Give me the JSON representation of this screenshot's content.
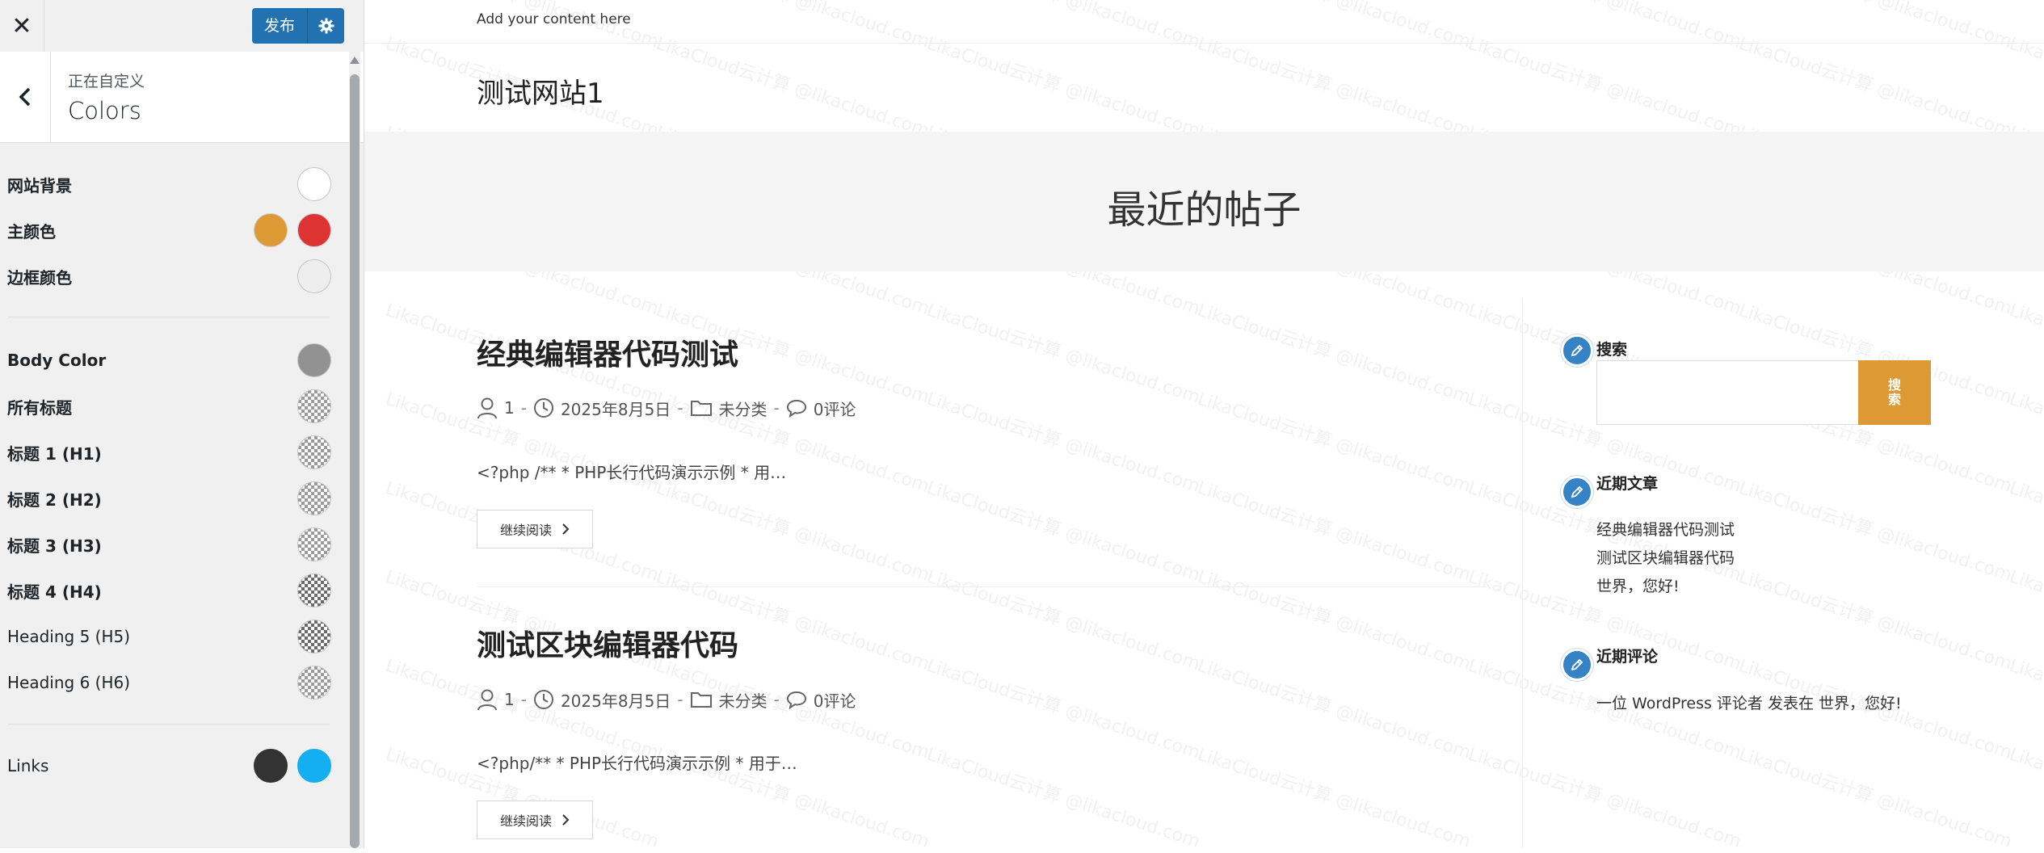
{
  "customizer": {
    "close_icon": "close-icon",
    "publish_label": "发布",
    "publish_settings_icon": "gear-icon",
    "back_icon": "chevron-left-icon",
    "customizing_label": "正在自定义",
    "section_title": "Colors",
    "controls": [
      {
        "label": "网站背景",
        "colors": [
          "#ffffff"
        ]
      },
      {
        "label": "主颜色",
        "colors": [
          "#dd9933",
          "#dd3333"
        ]
      },
      {
        "label": "边框颜色",
        "colors": [
          "#eeeeee"
        ]
      },
      {
        "label": "Body Color",
        "colors": [
          "#929292"
        ]
      },
      {
        "label": "所有标题",
        "colors": [
          "transparent"
        ]
      },
      {
        "label": "标题 1 (H1)",
        "colors": [
          "transparent"
        ]
      },
      {
        "label": "标题 2 (H2)",
        "colors": [
          "transparent"
        ]
      },
      {
        "label": "标题 3 (H3)",
        "colors": [
          "transparent"
        ]
      },
      {
        "label": "标题 4 (H4)",
        "colors": [
          "transparent"
        ]
      },
      {
        "label": "Heading 5 (H5)",
        "colors": [
          "transparent"
        ]
      },
      {
        "label": "Heading 6 (H6)",
        "colors": [
          "transparent"
        ]
      },
      {
        "label": "Links",
        "colors": [
          "#333333",
          "#13aff0"
        ]
      }
    ]
  },
  "preview": {
    "topbar_text": "Add your content here",
    "site_title": "测试网站1",
    "page_header_title": "最近的帖子",
    "posts": [
      {
        "title": "经典编辑器代码测试",
        "author": "1",
        "date": "2025年8月5日",
        "category": "未分类",
        "comments": "0评论",
        "excerpt": "<?php /** * PHP长行代码演示示例 * 用…",
        "read_more": "继续阅读"
      },
      {
        "title": "测试区块编辑器代码",
        "author": "1",
        "date": "2025年8月5日",
        "category": "未分类",
        "comments": "0评论",
        "excerpt": "<?php/** * PHP长行代码演示示例 * 用于…",
        "read_more": "继续阅读"
      }
    ],
    "meta_separator": "-",
    "widgets": {
      "search": {
        "title": "搜索",
        "submit_label": "搜索",
        "field_value": ""
      },
      "recent_posts": {
        "title": "近期文章",
        "items": [
          "经典编辑器代码测试",
          "测试区块编辑器代码",
          "世界，您好!"
        ]
      },
      "recent_comments": {
        "title": "近期评论",
        "text": "一位 WordPress 评论者 发表在 世界，您好!"
      }
    },
    "accent_color": "#dd9933",
    "watermark": "LikaCloud云计算 @likacloud.com"
  }
}
